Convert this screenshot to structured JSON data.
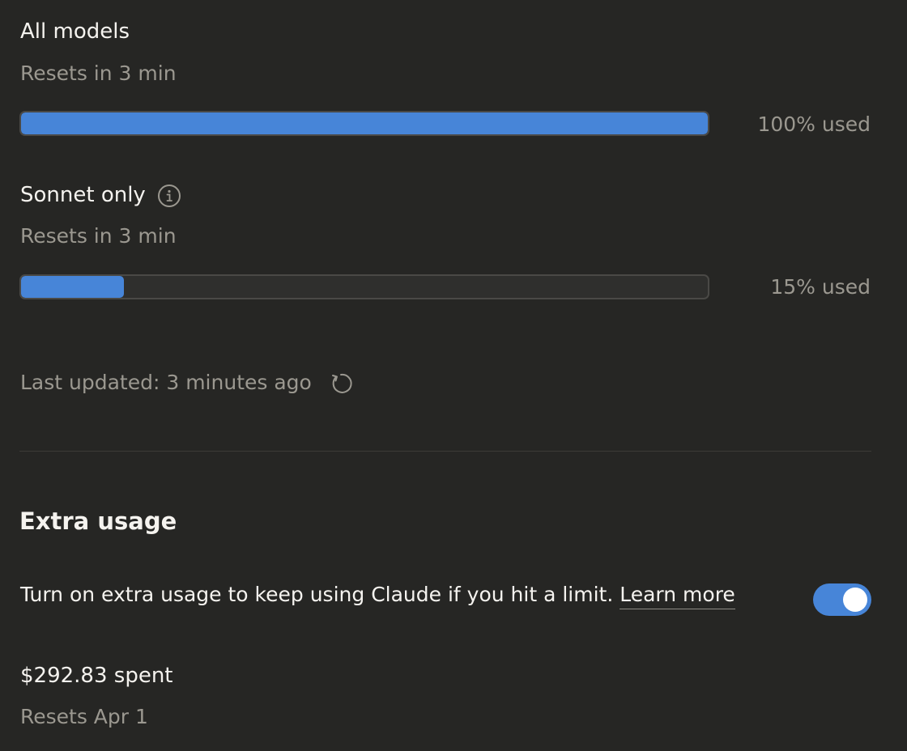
{
  "limits": [
    {
      "name": "All models",
      "reset": "Resets in 3 min",
      "usage_text": "100% used",
      "usage_fraction": 1.0
    },
    {
      "name": "Sonnet only",
      "reset": "Resets in 3 min",
      "usage_text": "15% used",
      "usage_fraction": 0.15
    }
  ],
  "last_updated": "Last updated: 3 minutes ago",
  "extra_usage": {
    "title": "Extra usage",
    "description": "Turn on extra usage to keep using Claude if you hit a limit.",
    "learn_more": "Learn more",
    "enabled": true,
    "spent": "$292.83 spent",
    "reset": "Resets Apr 1"
  },
  "colors": {
    "accent": "#4785d8",
    "background": "#262624"
  },
  "icons": {
    "info": "info-icon",
    "refresh": "refresh-icon"
  }
}
